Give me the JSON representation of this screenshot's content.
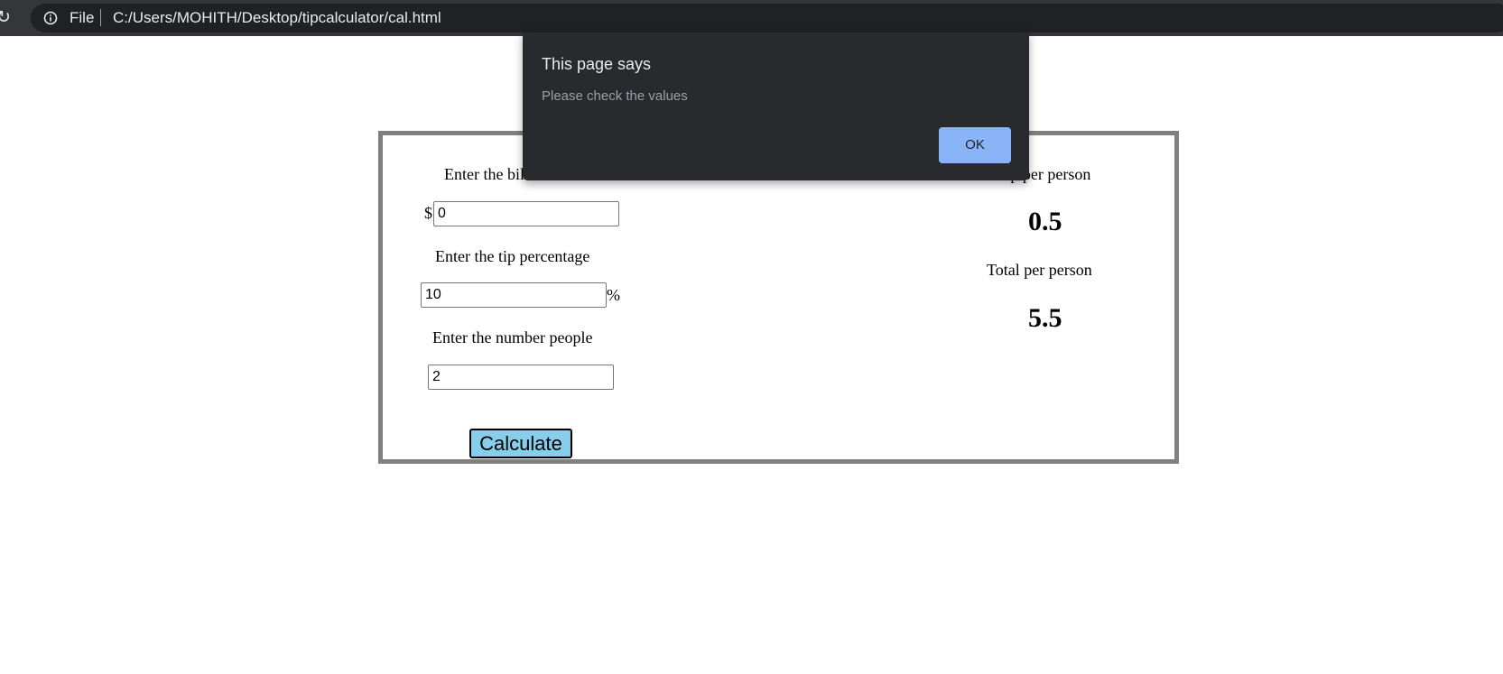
{
  "browser": {
    "scheme_label": "File",
    "url": "C:/Users/MOHITH/Desktop/tipcalculator/cal.html"
  },
  "calculator": {
    "bill_label": "Enter the bill amount",
    "currency_symbol": "$",
    "bill_value": "0",
    "tip_label": "Enter the tip percentage",
    "tip_value": "10",
    "percent_symbol": "%",
    "people_label": "Enter the number people",
    "people_value": "2",
    "calculate_label": "Calculate",
    "tip_per_person_label": "Tip per person",
    "tip_per_person_value": "0.5",
    "total_per_person_label": "Total per person",
    "total_per_person_value": "5.5",
    "accent_color": "#87ceeb"
  },
  "alert": {
    "title": "This page says",
    "message": "Please check the values",
    "ok_label": "OK",
    "accent_color": "#8ab4f8"
  },
  "icons": {
    "reload": "reload-icon",
    "info": "info-icon"
  }
}
